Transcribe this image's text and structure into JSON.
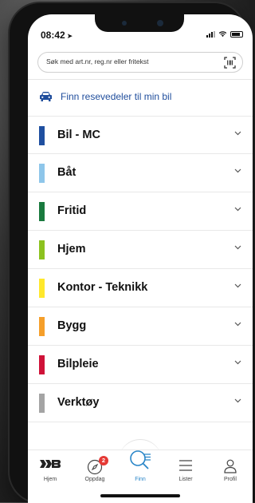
{
  "status_bar": {
    "time": "08:42",
    "location_arrow": "➤"
  },
  "search": {
    "placeholder": "Søk med art.nr, reg.nr eller fritekst",
    "barcode_icon": "barcode-scan-icon"
  },
  "find_parts": {
    "label": "Finn resevedeler til min bil",
    "icon": "car-icon"
  },
  "categories": [
    {
      "label": "Bil - MC",
      "color": "#1f4fa0"
    },
    {
      "label": "Båt",
      "color": "#8ec6ea"
    },
    {
      "label": "Fritid",
      "color": "#1a7a3e"
    },
    {
      "label": "Hjem",
      "color": "#8cc21f"
    },
    {
      "label": "Kontor - Teknikk",
      "color": "#ffe82c"
    },
    {
      "label": "Bygg",
      "color": "#f59f2a"
    },
    {
      "label": "Bilpleie",
      "color": "#cf1238"
    },
    {
      "label": "Verktøy",
      "color": "#a4a4a4"
    }
  ],
  "tabbar": {
    "tabs": [
      {
        "label": "Hjem",
        "icon": "biltema-logo-icon"
      },
      {
        "label": "Oppdag",
        "icon": "compass-icon",
        "badge": "2"
      },
      {
        "label": "Finn",
        "icon": "search-list-icon",
        "active": true
      },
      {
        "label": "Lister",
        "icon": "list-icon"
      },
      {
        "label": "Profil",
        "icon": "person-icon"
      }
    ]
  },
  "colors": {
    "accent": "#2a86c8",
    "link": "#1f4d9c",
    "badge": "#e53935"
  }
}
